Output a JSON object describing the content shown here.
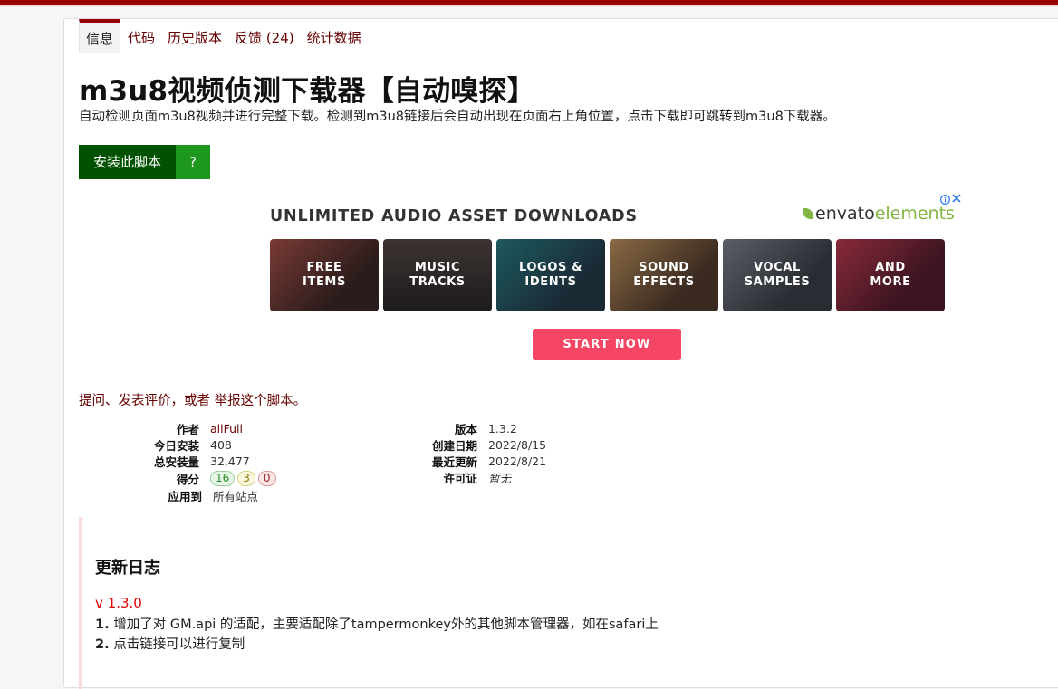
{
  "tabs": [
    {
      "label": "信息"
    },
    {
      "label": "代码"
    },
    {
      "label": "历史版本"
    },
    {
      "label": "反馈 (24)"
    },
    {
      "label": "统计数据"
    }
  ],
  "script": {
    "title": "m3u8视频侦测下载器【自动嗅探】",
    "description": "自动检测页面m3u8视频并进行完整下载。检测到m3u8链接后会自动出现在页面右上角位置，点击下载即可跳转到m3u8下载器。"
  },
  "install": {
    "label": "安装此脚本",
    "help": "?"
  },
  "ad": {
    "title": "UNLIMITED AUDIO ASSET DOWNLOADS",
    "logo_part1": "envato",
    "logo_part2": "elements",
    "info_icon": "info-icon",
    "close_icon": "close-icon",
    "tiles": [
      {
        "label": "FREE\nITEMS",
        "color": "#4a2e2a"
      },
      {
        "label": "MUSIC\nTRACKS",
        "color": "#2f2a2a"
      },
      {
        "label": "LOGOS &\nIDENTS",
        "color": "#1f3a3f"
      },
      {
        "label": "SOUND\nEFFECTS",
        "color": "#5a4330"
      },
      {
        "label": "VOCAL\nSAMPLES",
        "color": "#3a3d44"
      },
      {
        "label": "AND\nMORE",
        "color": "#5a1f2a"
      }
    ],
    "cta": "START NOW"
  },
  "ask": {
    "text": "提问、发表评价，或者",
    "link": "举报这个脚本",
    "end": "。"
  },
  "info_left": {
    "author_label": "作者",
    "author": "allFull",
    "today_label": "今日安装",
    "today": "408",
    "total_label": "总安装量",
    "total": "32,477",
    "score_label": "得分",
    "score_good": "16",
    "score_ok": "3",
    "score_bad": "0",
    "applies_label": "应用到",
    "applies": "所有站点"
  },
  "info_right": {
    "version_label": "版本",
    "version": "1.3.2",
    "created_label": "创建日期",
    "created": "2022/8/15",
    "updated_label": "最近更新",
    "updated": "2022/8/21",
    "license_label": "许可证",
    "license": "暂无"
  },
  "changelog": {
    "title": "更新日志",
    "version": "v 1.3.0",
    "items": [
      {
        "num": "1.",
        "text": " 增加了对 GM.api 的适配，主要适配除了tampermonkey外的其他脚本管理器，如在safari上"
      },
      {
        "num": "2.",
        "text": " 点击链接可以进行复制"
      }
    ]
  },
  "colors": {
    "brand": "#990000",
    "install": "#005200",
    "install_help": "#1e971e",
    "cta": "#f64665",
    "changelog_version": "#e00000"
  }
}
